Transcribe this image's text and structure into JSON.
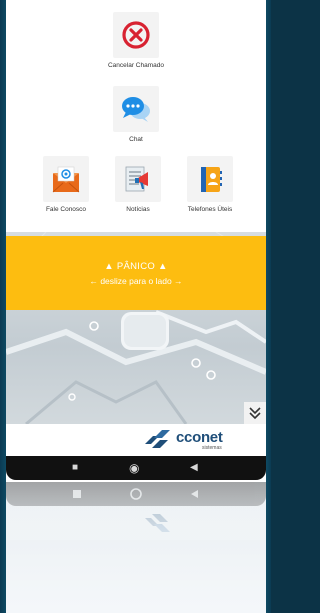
{
  "menu": {
    "cancel": {
      "label": "Cancelar Chamado",
      "icon": "cancel-x-icon"
    },
    "chat": {
      "label": "Chat",
      "icon": "chat-bubbles-icon"
    },
    "contact": {
      "label": "Fale Conosco",
      "icon": "email-envelope-icon"
    },
    "news": {
      "label": "Notícias",
      "icon": "news-megaphone-icon"
    },
    "phones": {
      "label": "Telefones Úteis",
      "icon": "phonebook-icon"
    }
  },
  "panic": {
    "title": "▲ PÂNICO ▲",
    "hint": "← deslize para o lado →",
    "color": "#fdbd10"
  },
  "expand": {
    "icon": "double-chevron-down-icon",
    "glyph": "≫"
  },
  "brand": {
    "name": "cconet",
    "sub": "sistemas",
    "color": "#1f4e79"
  },
  "navbar": {
    "square": "■",
    "circle": "◉",
    "back": "◀"
  }
}
